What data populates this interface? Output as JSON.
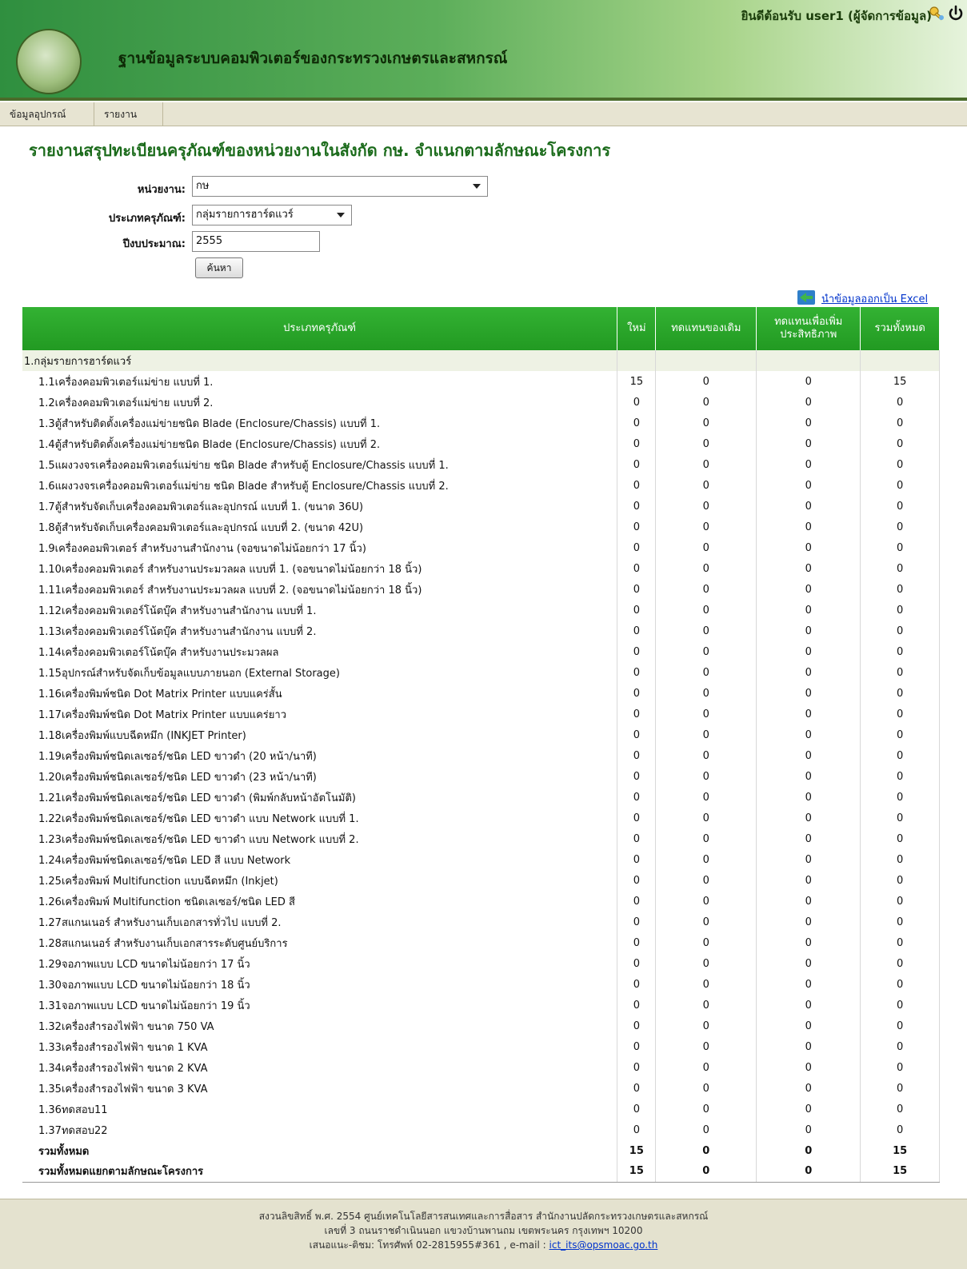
{
  "header": {
    "welcome": "ยินดีต้อนรับ",
    "user": "user1 (ผู้จัดการข้อมูล)",
    "site_title": "ฐานข้อมูลระบบคอมพิวเตอร์ของกระทรวงเกษตรและสหกรณ์",
    "icons": [
      "key-icon",
      "power-icon"
    ]
  },
  "menu": [
    "ข้อมูลอุปกรณ์",
    "รายงาน"
  ],
  "report_title": "รายงานสรุปทะเบียนครุภัณฑ์ของหน่วยงานในสังกัด กษ. จำแนกตามลักษณะโครงการ",
  "filters": {
    "agency_label": "หน่วยงาน:",
    "agency_value": "กษ",
    "type_label": "ประเภทครุภัณฑ์:",
    "type_value": "กลุ่มรายการฮาร์ดแวร์",
    "year_label": "ปีงบประมาณ:",
    "year_value": "2555",
    "search_button": "ค้นหา"
  },
  "excel_link": "นำข้อมูลออกเป็น Excel",
  "table": {
    "headers": [
      "ประเภทครุภัณฑ์",
      "ใหม่",
      "ทดแทนของเดิม",
      "ทดแทนเพื่อเพิ่มประสิทธิภาพ",
      "รวมทั้งหมด"
    ],
    "group": "1.กลุ่มรายการฮาร์ดแวร์",
    "rows": [
      {
        "name": "1.1เครื่องคอมพิวเตอร์แม่ข่าย แบบที่ 1.",
        "v": [
          "15",
          "0",
          "0",
          "15"
        ]
      },
      {
        "name": "1.2เครื่องคอมพิวเตอร์แม่ข่าย แบบที่ 2.",
        "v": [
          "0",
          "0",
          "0",
          "0"
        ]
      },
      {
        "name": "1.3ตู้สำหรับติดตั้งเครื่องแม่ข่ายชนิด Blade (Enclosure/Chassis) แบบที่ 1.",
        "v": [
          "0",
          "0",
          "0",
          "0"
        ]
      },
      {
        "name": "1.4ตู้สำหรับติดตั้งเครื่องแม่ข่ายชนิด Blade (Enclosure/Chassis) แบบที่ 2.",
        "v": [
          "0",
          "0",
          "0",
          "0"
        ]
      },
      {
        "name": "1.5แผงวงจรเครื่องคอมพิวเตอร์แม่ข่าย ชนิด Blade สำหรับตู้ Enclosure/Chassis แบบที่ 1.",
        "v": [
          "0",
          "0",
          "0",
          "0"
        ]
      },
      {
        "name": "1.6แผงวงจรเครื่องคอมพิวเตอร์แม่ข่าย ชนิด Blade สำหรับตู้ Enclosure/Chassis แบบที่ 2.",
        "v": [
          "0",
          "0",
          "0",
          "0"
        ]
      },
      {
        "name": "1.7ตู้สำหรับจัดเก็บเครื่องคอมพิวเตอร์และอุปกรณ์ แบบที่ 1. (ขนาด 36U)",
        "v": [
          "0",
          "0",
          "0",
          "0"
        ]
      },
      {
        "name": "1.8ตู้สำหรับจัดเก็บเครื่องคอมพิวเตอร์และอุปกรณ์ แบบที่ 2. (ขนาด 42U)",
        "v": [
          "0",
          "0",
          "0",
          "0"
        ]
      },
      {
        "name": "1.9เครื่องคอมพิวเตอร์ สำหรับงานสำนักงาน (จอขนาดไม่น้อยกว่า 17 นิ้ว)",
        "v": [
          "0",
          "0",
          "0",
          "0"
        ]
      },
      {
        "name": "1.10เครื่องคอมพิวเตอร์ สำหรับงานประมวลผล แบบที่ 1. (จอขนาดไม่น้อยกว่า 18 นิ้ว)",
        "v": [
          "0",
          "0",
          "0",
          "0"
        ]
      },
      {
        "name": "1.11เครื่องคอมพิวเตอร์ สำหรับงานประมวลผล แบบที่ 2. (จอขนาดไม่น้อยกว่า 18 นิ้ว)",
        "v": [
          "0",
          "0",
          "0",
          "0"
        ]
      },
      {
        "name": "1.12เครื่องคอมพิวเตอร์โน้ตบุ๊ค สำหรับงานสำนักงาน แบบที่ 1.",
        "v": [
          "0",
          "0",
          "0",
          "0"
        ]
      },
      {
        "name": "1.13เครื่องคอมพิวเตอร์โน้ตบุ๊ค สำหรับงานสำนักงาน แบบที่ 2.",
        "v": [
          "0",
          "0",
          "0",
          "0"
        ]
      },
      {
        "name": "1.14เครื่องคอมพิวเตอร์โน้ตบุ๊ค สำหรับงานประมวลผล",
        "v": [
          "0",
          "0",
          "0",
          "0"
        ]
      },
      {
        "name": "1.15อุปกรณ์สำหรับจัดเก็บข้อมูลแบบภายนอก (External Storage)",
        "v": [
          "0",
          "0",
          "0",
          "0"
        ]
      },
      {
        "name": "1.16เครื่องพิมพ์ชนิด Dot Matrix Printer แบบแคร่สั้น",
        "v": [
          "0",
          "0",
          "0",
          "0"
        ]
      },
      {
        "name": "1.17เครื่องพิมพ์ชนิด Dot Matrix Printer แบบแคร่ยาว",
        "v": [
          "0",
          "0",
          "0",
          "0"
        ]
      },
      {
        "name": "1.18เครื่องพิมพ์แบบฉีดหมึก (INKJET Printer)",
        "v": [
          "0",
          "0",
          "0",
          "0"
        ]
      },
      {
        "name": "1.19เครื่องพิมพ์ชนิดเลเซอร์/ชนิด LED ขาวดำ (20 หน้า/นาที)",
        "v": [
          "0",
          "0",
          "0",
          "0"
        ]
      },
      {
        "name": "1.20เครื่องพิมพ์ชนิดเลเซอร์/ชนิด LED ขาวดำ (23 หน้า/นาที)",
        "v": [
          "0",
          "0",
          "0",
          "0"
        ]
      },
      {
        "name": "1.21เครื่องพิมพ์ชนิดเลเซอร์/ชนิด LED ขาวดำ (พิมพ์กลับหน้าอัตโนมัติ)",
        "v": [
          "0",
          "0",
          "0",
          "0"
        ]
      },
      {
        "name": "1.22เครื่องพิมพ์ชนิดเลเซอร์/ชนิด LED ขาวดำ แบบ Network แบบที่ 1.",
        "v": [
          "0",
          "0",
          "0",
          "0"
        ]
      },
      {
        "name": "1.23เครื่องพิมพ์ชนิดเลเซอร์/ชนิด LED ขาวดำ แบบ Network แบบที่ 2.",
        "v": [
          "0",
          "0",
          "0",
          "0"
        ]
      },
      {
        "name": "1.24เครื่องพิมพ์ชนิดเลเซอร์/ชนิด LED สี แบบ Network",
        "v": [
          "0",
          "0",
          "0",
          "0"
        ]
      },
      {
        "name": "1.25เครื่องพิมพ์ Multifunction แบบฉีดหมึก (Inkjet)",
        "v": [
          "0",
          "0",
          "0",
          "0"
        ]
      },
      {
        "name": "1.26เครื่องพิมพ์ Multifunction ชนิดเลเซอร์/ชนิด LED สี",
        "v": [
          "0",
          "0",
          "0",
          "0"
        ]
      },
      {
        "name": "1.27สแกนเนอร์ สำหรับงานเก็บเอกสารทั่วไป แบบที่ 2.",
        "v": [
          "0",
          "0",
          "0",
          "0"
        ]
      },
      {
        "name": "1.28สแกนเนอร์ สำหรับงานเก็บเอกสารระดับศูนย์บริการ",
        "v": [
          "0",
          "0",
          "0",
          "0"
        ]
      },
      {
        "name": "1.29จอภาพแบบ LCD ขนาดไม่น้อยกว่า 17 นิ้ว",
        "v": [
          "0",
          "0",
          "0",
          "0"
        ]
      },
      {
        "name": "1.30จอภาพแบบ LCD ขนาดไม่น้อยกว่า 18 นิ้ว",
        "v": [
          "0",
          "0",
          "0",
          "0"
        ]
      },
      {
        "name": "1.31จอภาพแบบ LCD ขนาดไม่น้อยกว่า 19 นิ้ว",
        "v": [
          "0",
          "0",
          "0",
          "0"
        ]
      },
      {
        "name": "1.32เครื่องสำรองไฟฟ้า ขนาด 750 VA",
        "v": [
          "0",
          "0",
          "0",
          "0"
        ]
      },
      {
        "name": "1.33เครื่องสำรองไฟฟ้า ขนาด 1 KVA",
        "v": [
          "0",
          "0",
          "0",
          "0"
        ]
      },
      {
        "name": "1.34เครื่องสำรองไฟฟ้า ขนาด 2 KVA",
        "v": [
          "0",
          "0",
          "0",
          "0"
        ]
      },
      {
        "name": "1.35เครื่องสำรองไฟฟ้า ขนาด 3 KVA",
        "v": [
          "0",
          "0",
          "0",
          "0"
        ]
      },
      {
        "name": "1.36ทดสอบ11",
        "v": [
          "0",
          "0",
          "0",
          "0"
        ]
      },
      {
        "name": "1.37ทดสอบ22",
        "v": [
          "0",
          "0",
          "0",
          "0"
        ]
      }
    ],
    "totals": [
      {
        "name": "รวมทั้งหมด",
        "v": [
          "15",
          "0",
          "0",
          "15"
        ]
      },
      {
        "name": "รวมทั้งหมดแยกตามลักษณะโครงการ",
        "v": [
          "15",
          "0",
          "0",
          "15"
        ]
      }
    ]
  },
  "footer": {
    "line1": "สงวนลิขสิทธิ์ พ.ศ. 2554 ศูนย์เทคโนโลยีสารสนเทศและการสื่อสาร สำนักงานปลัดกระทรวงเกษตรและสหกรณ์",
    "line2": "เลขที่ 3 ถนนราชดำเนินนอก แขวงบ้านพานถม เขตพระนคร กรุงเทพฯ 10200",
    "line3_prefix": "เสนอแนะ-ติชม: โทรศัพท์ 02-2815955#361 , e-mail : ",
    "email": "ict_its@opsmoac.go.th"
  }
}
